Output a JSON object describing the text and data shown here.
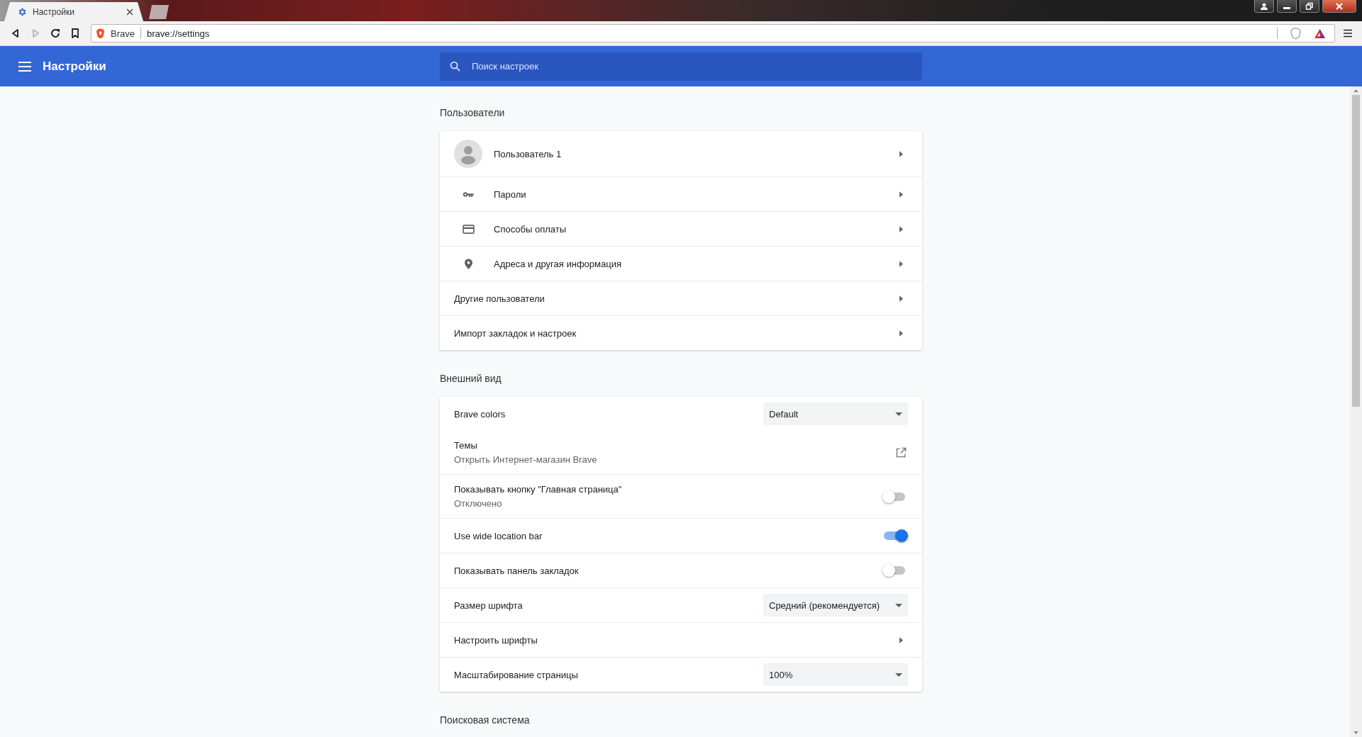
{
  "window": {
    "tabs": [
      {
        "title": "Настройки",
        "selected": true
      },
      {
        "selected": false
      }
    ]
  },
  "toolbar": {
    "nav_buttons": [
      {
        "kind": "back",
        "disabled": false
      },
      {
        "kind": "forward",
        "disabled": true
      },
      {
        "kind": "reload",
        "disabled": false
      },
      {
        "kind": "bookmark",
        "disabled": false
      }
    ],
    "address_bar": {
      "brand": "Brave",
      "url": "brave://settings"
    }
  },
  "header": {
    "title": "Настройки",
    "search": {
      "placeholder": "Поиск настроек"
    }
  },
  "sections": [
    {
      "title": "Пользователи",
      "rows": [
        {
          "kind": "profile",
          "label": "Пользователь 1"
        },
        {
          "kind": "passwords",
          "label": "Пароли"
        },
        {
          "kind": "payments",
          "label": "Способы оплаты"
        },
        {
          "kind": "addresses",
          "label": "Адреса и другая информация"
        },
        {
          "kind": "link",
          "label": "Другие пользователи"
        },
        {
          "kind": "link",
          "label": "Импорт закладок и настроек"
        }
      ]
    },
    {
      "title": "Внешний вид",
      "rows": [
        {
          "kind": "select",
          "label": "Brave colors",
          "value": "Default"
        },
        {
          "kind": "external",
          "label": "Темы",
          "sublabel": "Открыть Интернет-магазин Brave"
        },
        {
          "kind": "toggle",
          "label": "Показывать кнопку \"Главная страница\"",
          "sublabel": "Отключено",
          "on": false
        },
        {
          "kind": "toggle",
          "label": "Use wide location bar",
          "on": true
        },
        {
          "kind": "toggle",
          "label": "Показывать панель закладок",
          "on": false
        },
        {
          "kind": "select",
          "label": "Размер шрифта",
          "value": "Средний (рекомендуется)"
        },
        {
          "kind": "link",
          "label": "Настроить шрифты"
        },
        {
          "kind": "select",
          "label": "Масштабирование страницы",
          "value": "100%"
        }
      ]
    },
    {
      "title": "Поисковая система"
    }
  ]
}
